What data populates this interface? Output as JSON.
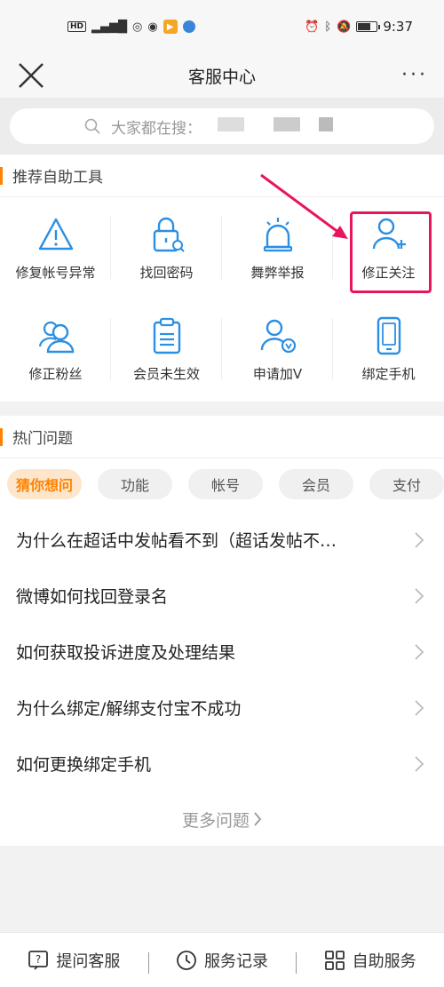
{
  "status_bar": {
    "time": "9:37",
    "hd": "HD",
    "network": "4G"
  },
  "nav": {
    "title": "客服中心",
    "more": "···"
  },
  "search": {
    "placeholder": "大家都在搜："
  },
  "tools": {
    "title": "推荐自助工具",
    "items": [
      {
        "label": "修复帐号异常",
        "icon": "warning-icon"
      },
      {
        "label": "找回密码",
        "icon": "lock-search-icon"
      },
      {
        "label": "舞弊举报",
        "icon": "alarm-icon"
      },
      {
        "label": "修正关注",
        "icon": "user-add-icon"
      },
      {
        "label": "修正粉丝",
        "icon": "users-icon"
      },
      {
        "label": "会员未生效",
        "icon": "clipboard-icon"
      },
      {
        "label": "申请加V",
        "icon": "user-verified-icon"
      },
      {
        "label": "绑定手机",
        "icon": "phone-icon"
      }
    ]
  },
  "faq": {
    "title": "热门问题",
    "tabs": [
      "猜你想问",
      "功能",
      "帐号",
      "会员",
      "支付"
    ],
    "active_tab": 0,
    "questions": [
      "为什么在超话中发帖看不到（超话发帖不…",
      "微博如何找回登录名",
      "如何获取投诉进度及处理结果",
      "为什么绑定/解绑支付宝不成功",
      "如何更换绑定手机"
    ],
    "more": "更多问题"
  },
  "bottom_bar": {
    "ask": "提问客服",
    "records": "服务记录",
    "self_service": "自助服务"
  },
  "colors": {
    "accent": "#ff8200",
    "icon_blue": "#2b8fe3",
    "highlight": "#e8155b"
  }
}
